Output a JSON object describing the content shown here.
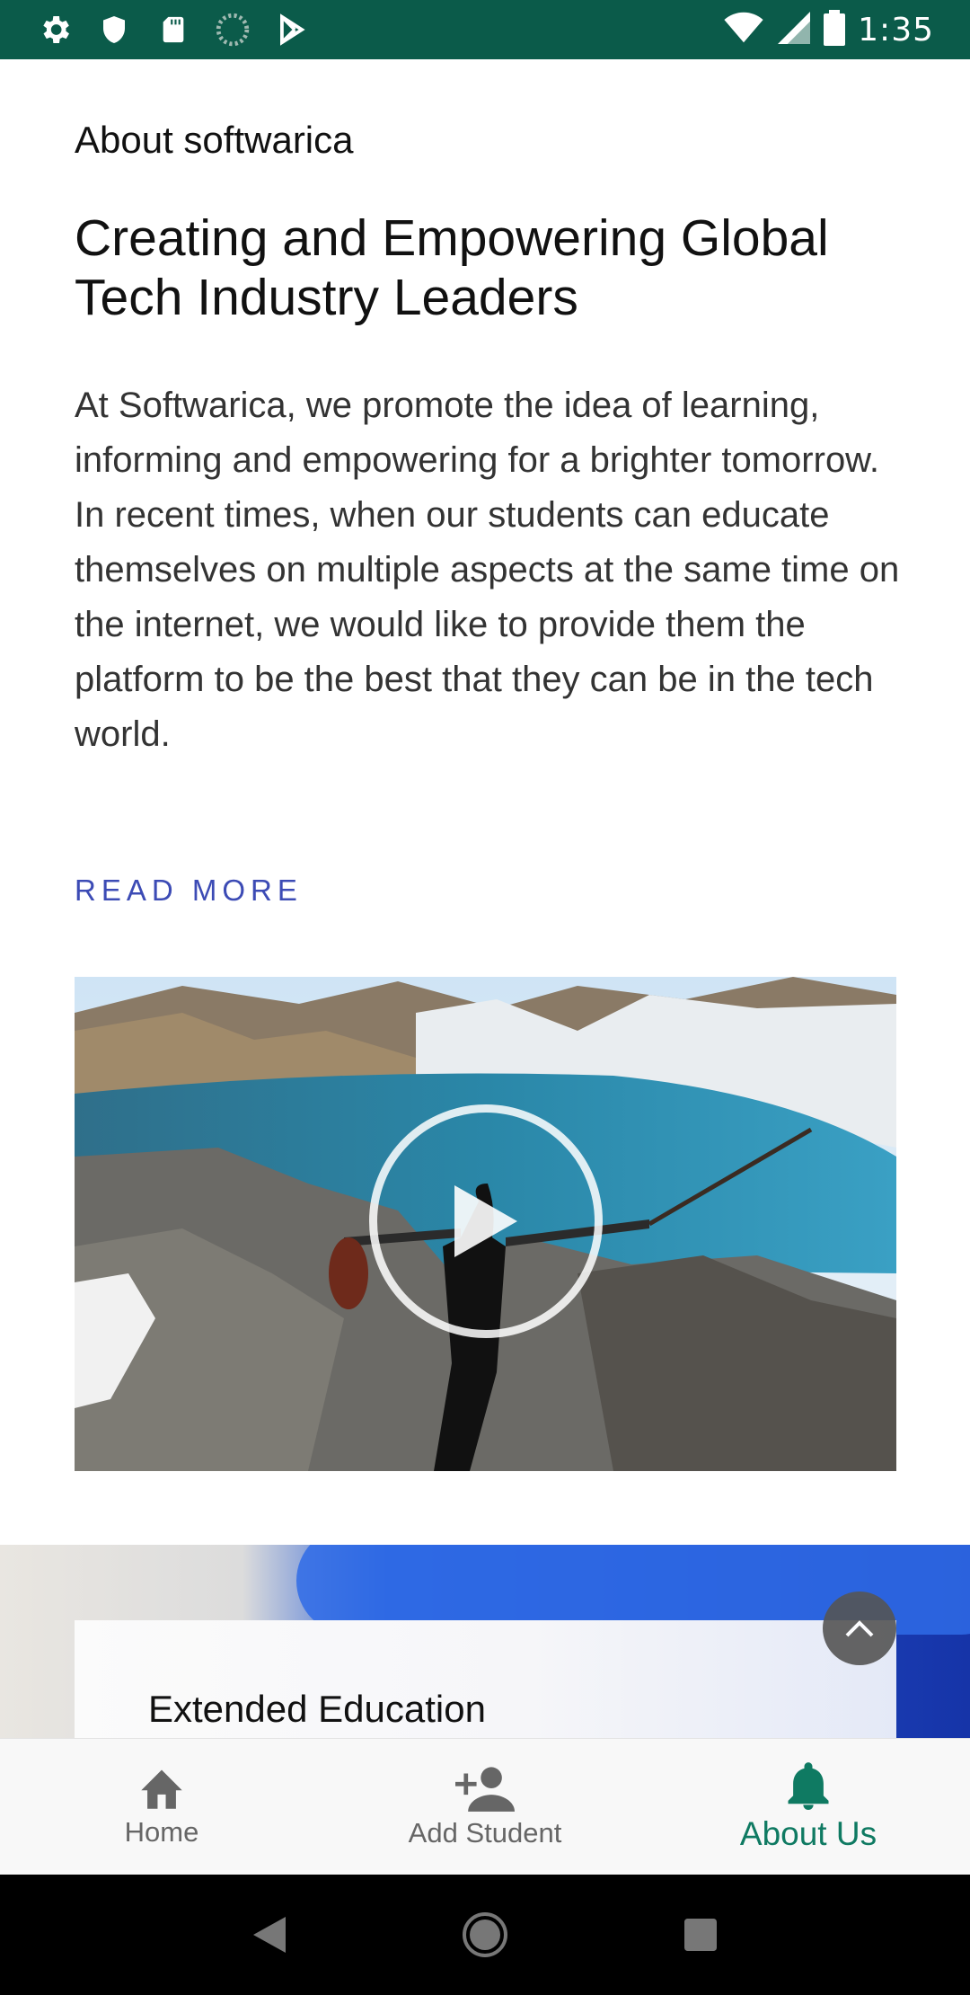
{
  "status_bar": {
    "time": "1:35",
    "left_icons": [
      "settings-icon",
      "shield-icon",
      "sd-card-icon",
      "sync-icon",
      "play-store-icon"
    ],
    "right_icons": [
      "wifi-icon",
      "signal-icon",
      "battery-icon"
    ]
  },
  "about": {
    "section_label": "About softwarica",
    "headline": "Creating and Empowering Global Tech Industry Leaders",
    "body": "At Softwarica, we promote the idea of learning, informing and empowering for a brighter tomorrow. In recent times, when our students can educate themselves on multiple aspects at the same time on the internet, we would like to provide them the platform to be the best that they can be in the tech world.",
    "read_more": "READ MORE"
  },
  "video": {
    "play_icon": "play-icon"
  },
  "extended": {
    "card_title": "Extended Education"
  },
  "bottom_nav": {
    "items": [
      {
        "label": "Home",
        "icon": "home-icon",
        "active": false
      },
      {
        "label": "Add Student",
        "icon": "add-person-icon",
        "active": false
      },
      {
        "label": "About Us",
        "icon": "bell-icon",
        "active": true
      }
    ]
  },
  "colors": {
    "status_bar": "#0b5b4a",
    "accent": "#0f7a62",
    "link": "#3c4bb5"
  }
}
